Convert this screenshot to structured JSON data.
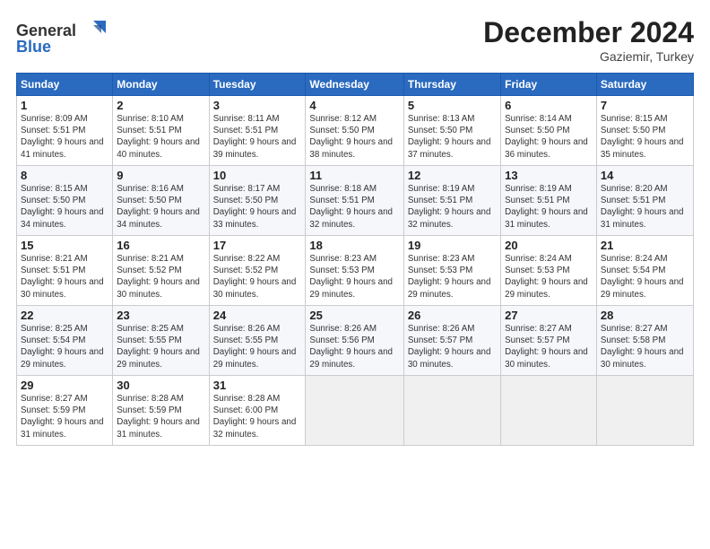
{
  "header": {
    "logo_line1": "General",
    "logo_line2": "Blue",
    "month": "December 2024",
    "location": "Gaziemir, Turkey"
  },
  "days_of_week": [
    "Sunday",
    "Monday",
    "Tuesday",
    "Wednesday",
    "Thursday",
    "Friday",
    "Saturday"
  ],
  "weeks": [
    [
      {
        "day": "1",
        "sunrise": "Sunrise: 8:09 AM",
        "sunset": "Sunset: 5:51 PM",
        "daylight": "Daylight: 9 hours and 41 minutes."
      },
      {
        "day": "2",
        "sunrise": "Sunrise: 8:10 AM",
        "sunset": "Sunset: 5:51 PM",
        "daylight": "Daylight: 9 hours and 40 minutes."
      },
      {
        "day": "3",
        "sunrise": "Sunrise: 8:11 AM",
        "sunset": "Sunset: 5:51 PM",
        "daylight": "Daylight: 9 hours and 39 minutes."
      },
      {
        "day": "4",
        "sunrise": "Sunrise: 8:12 AM",
        "sunset": "Sunset: 5:50 PM",
        "daylight": "Daylight: 9 hours and 38 minutes."
      },
      {
        "day": "5",
        "sunrise": "Sunrise: 8:13 AM",
        "sunset": "Sunset: 5:50 PM",
        "daylight": "Daylight: 9 hours and 37 minutes."
      },
      {
        "day": "6",
        "sunrise": "Sunrise: 8:14 AM",
        "sunset": "Sunset: 5:50 PM",
        "daylight": "Daylight: 9 hours and 36 minutes."
      },
      {
        "day": "7",
        "sunrise": "Sunrise: 8:15 AM",
        "sunset": "Sunset: 5:50 PM",
        "daylight": "Daylight: 9 hours and 35 minutes."
      }
    ],
    [
      {
        "day": "8",
        "sunrise": "Sunrise: 8:15 AM",
        "sunset": "Sunset: 5:50 PM",
        "daylight": "Daylight: 9 hours and 34 minutes."
      },
      {
        "day": "9",
        "sunrise": "Sunrise: 8:16 AM",
        "sunset": "Sunset: 5:50 PM",
        "daylight": "Daylight: 9 hours and 34 minutes."
      },
      {
        "day": "10",
        "sunrise": "Sunrise: 8:17 AM",
        "sunset": "Sunset: 5:50 PM",
        "daylight": "Daylight: 9 hours and 33 minutes."
      },
      {
        "day": "11",
        "sunrise": "Sunrise: 8:18 AM",
        "sunset": "Sunset: 5:51 PM",
        "daylight": "Daylight: 9 hours and 32 minutes."
      },
      {
        "day": "12",
        "sunrise": "Sunrise: 8:19 AM",
        "sunset": "Sunset: 5:51 PM",
        "daylight": "Daylight: 9 hours and 32 minutes."
      },
      {
        "day": "13",
        "sunrise": "Sunrise: 8:19 AM",
        "sunset": "Sunset: 5:51 PM",
        "daylight": "Daylight: 9 hours and 31 minutes."
      },
      {
        "day": "14",
        "sunrise": "Sunrise: 8:20 AM",
        "sunset": "Sunset: 5:51 PM",
        "daylight": "Daylight: 9 hours and 31 minutes."
      }
    ],
    [
      {
        "day": "15",
        "sunrise": "Sunrise: 8:21 AM",
        "sunset": "Sunset: 5:51 PM",
        "daylight": "Daylight: 9 hours and 30 minutes."
      },
      {
        "day": "16",
        "sunrise": "Sunrise: 8:21 AM",
        "sunset": "Sunset: 5:52 PM",
        "daylight": "Daylight: 9 hours and 30 minutes."
      },
      {
        "day": "17",
        "sunrise": "Sunrise: 8:22 AM",
        "sunset": "Sunset: 5:52 PM",
        "daylight": "Daylight: 9 hours and 30 minutes."
      },
      {
        "day": "18",
        "sunrise": "Sunrise: 8:23 AM",
        "sunset": "Sunset: 5:53 PM",
        "daylight": "Daylight: 9 hours and 29 minutes."
      },
      {
        "day": "19",
        "sunrise": "Sunrise: 8:23 AM",
        "sunset": "Sunset: 5:53 PM",
        "daylight": "Daylight: 9 hours and 29 minutes."
      },
      {
        "day": "20",
        "sunrise": "Sunrise: 8:24 AM",
        "sunset": "Sunset: 5:53 PM",
        "daylight": "Daylight: 9 hours and 29 minutes."
      },
      {
        "day": "21",
        "sunrise": "Sunrise: 8:24 AM",
        "sunset": "Sunset: 5:54 PM",
        "daylight": "Daylight: 9 hours and 29 minutes."
      }
    ],
    [
      {
        "day": "22",
        "sunrise": "Sunrise: 8:25 AM",
        "sunset": "Sunset: 5:54 PM",
        "daylight": "Daylight: 9 hours and 29 minutes."
      },
      {
        "day": "23",
        "sunrise": "Sunrise: 8:25 AM",
        "sunset": "Sunset: 5:55 PM",
        "daylight": "Daylight: 9 hours and 29 minutes."
      },
      {
        "day": "24",
        "sunrise": "Sunrise: 8:26 AM",
        "sunset": "Sunset: 5:55 PM",
        "daylight": "Daylight: 9 hours and 29 minutes."
      },
      {
        "day": "25",
        "sunrise": "Sunrise: 8:26 AM",
        "sunset": "Sunset: 5:56 PM",
        "daylight": "Daylight: 9 hours and 29 minutes."
      },
      {
        "day": "26",
        "sunrise": "Sunrise: 8:26 AM",
        "sunset": "Sunset: 5:57 PM",
        "daylight": "Daylight: 9 hours and 30 minutes."
      },
      {
        "day": "27",
        "sunrise": "Sunrise: 8:27 AM",
        "sunset": "Sunset: 5:57 PM",
        "daylight": "Daylight: 9 hours and 30 minutes."
      },
      {
        "day": "28",
        "sunrise": "Sunrise: 8:27 AM",
        "sunset": "Sunset: 5:58 PM",
        "daylight": "Daylight: 9 hours and 30 minutes."
      }
    ],
    [
      {
        "day": "29",
        "sunrise": "Sunrise: 8:27 AM",
        "sunset": "Sunset: 5:59 PM",
        "daylight": "Daylight: 9 hours and 31 minutes."
      },
      {
        "day": "30",
        "sunrise": "Sunrise: 8:28 AM",
        "sunset": "Sunset: 5:59 PM",
        "daylight": "Daylight: 9 hours and 31 minutes."
      },
      {
        "day": "31",
        "sunrise": "Sunrise: 8:28 AM",
        "sunset": "Sunset: 6:00 PM",
        "daylight": "Daylight: 9 hours and 32 minutes."
      },
      null,
      null,
      null,
      null
    ]
  ]
}
